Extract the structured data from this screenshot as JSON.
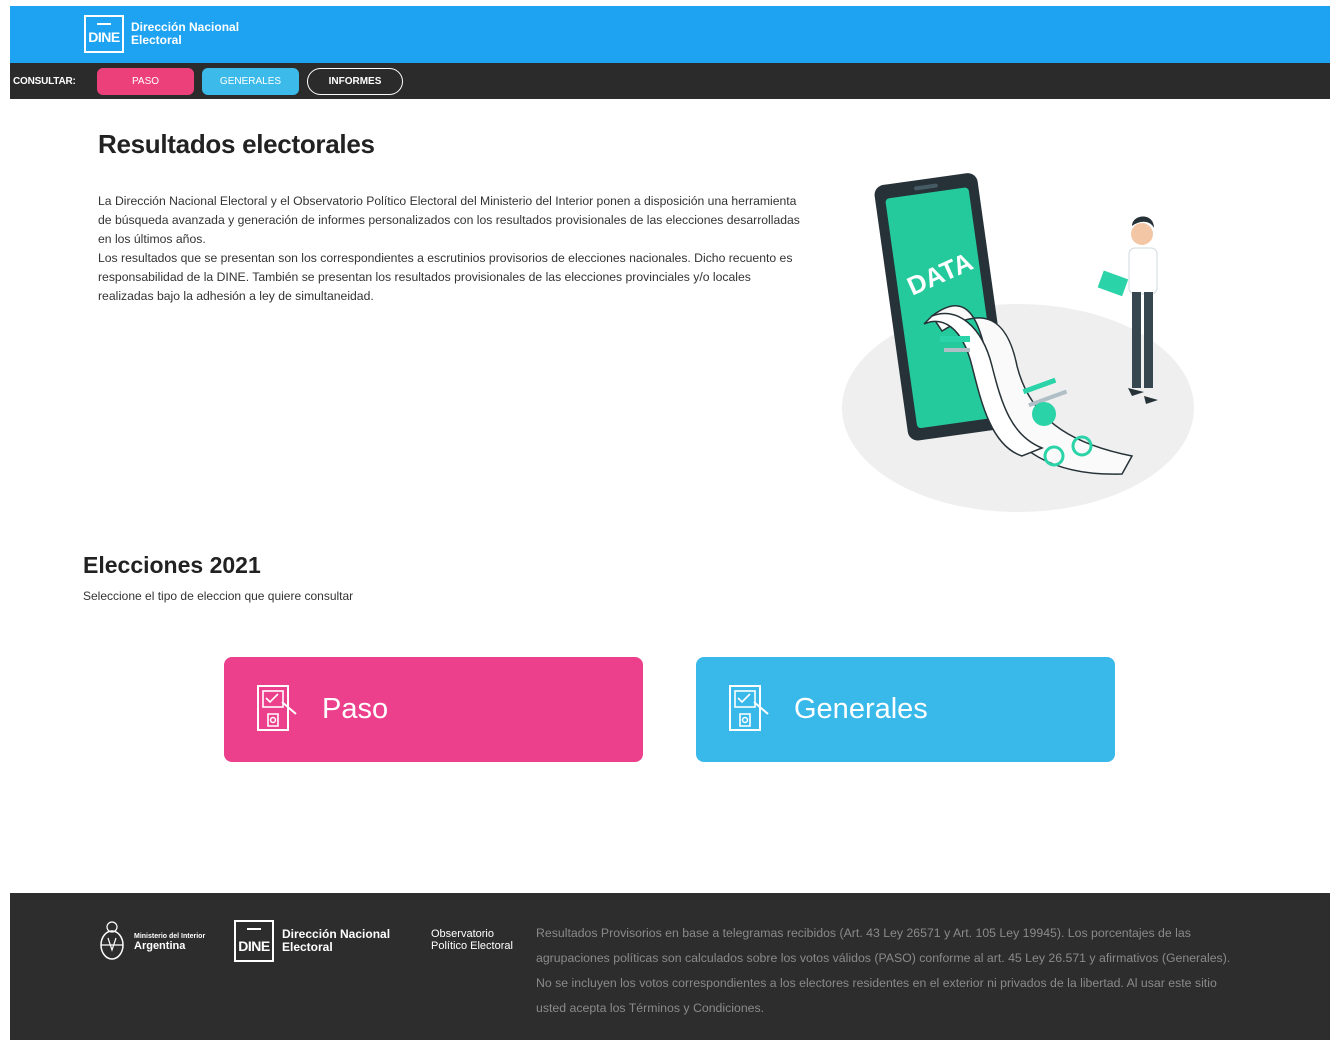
{
  "header": {
    "logo_abbr": "DINE",
    "logo_line1": "Dirección Nacional",
    "logo_line2": "Electoral"
  },
  "nav": {
    "label": "CONSULTAR:",
    "items": [
      "PASO",
      "GENERALES",
      "INFORMES"
    ]
  },
  "intro": {
    "title": "Resultados electorales",
    "paragraph1": "La Dirección Nacional Electoral y el Observatorio Político Electoral del Ministerio del Interior ponen a disposición una herramienta de búsqueda avanzada y generación de informes personalizados con los resultados provisionales de las elecciones desarrolladas en los últimos años.",
    "paragraph2": "Los resultados que se presentan son los correspondientes a escrutinios provisorios de elecciones nacionales. Dicho recuento es responsabilidad de la DINE. También se presentan los resultados provisionales de las elecciones provinciales y/o locales realizadas bajo la adhesión a ley de simultaneidad.",
    "illustration_text": "DATA"
  },
  "elections": {
    "title": "Elecciones 2021",
    "subtitle": "Seleccione el tipo de eleccion que quiere consultar",
    "cards": [
      "Paso",
      "Generales"
    ]
  },
  "footer": {
    "ministry_line1": "Ministerio del Interior",
    "ministry_line2": "Argentina",
    "dine_abbr": "DINE",
    "dine_line1": "Dirección Nacional",
    "dine_line2": "Electoral",
    "obs_line1": "Observatorio",
    "obs_line2": "Político Electoral",
    "legal": "Resultados Provisorios en base a telegramas recibidos (Art. 43 Ley 26571 y Art. 105 Ley 19945). Los porcentajes de las agrupaciones políticas son calculados sobre los votos válidos (PASO) conforme al art. 45 Ley 26.571 y afirmativos (Generales). No se incluyen los votos correspondientes a los electores residentes en el exterior ni privados de la libertad. Al usar este sitio usted acepta los Términos y Condiciones."
  },
  "colors": {
    "header_blue": "#1ea3f3",
    "nav_dark": "#2b2b2b",
    "paso_pink": "#ec3f8c",
    "generales_blue": "#39b9ea",
    "footer_dark": "#2d2d2d",
    "illustration_accent": "#2bd4a8"
  }
}
